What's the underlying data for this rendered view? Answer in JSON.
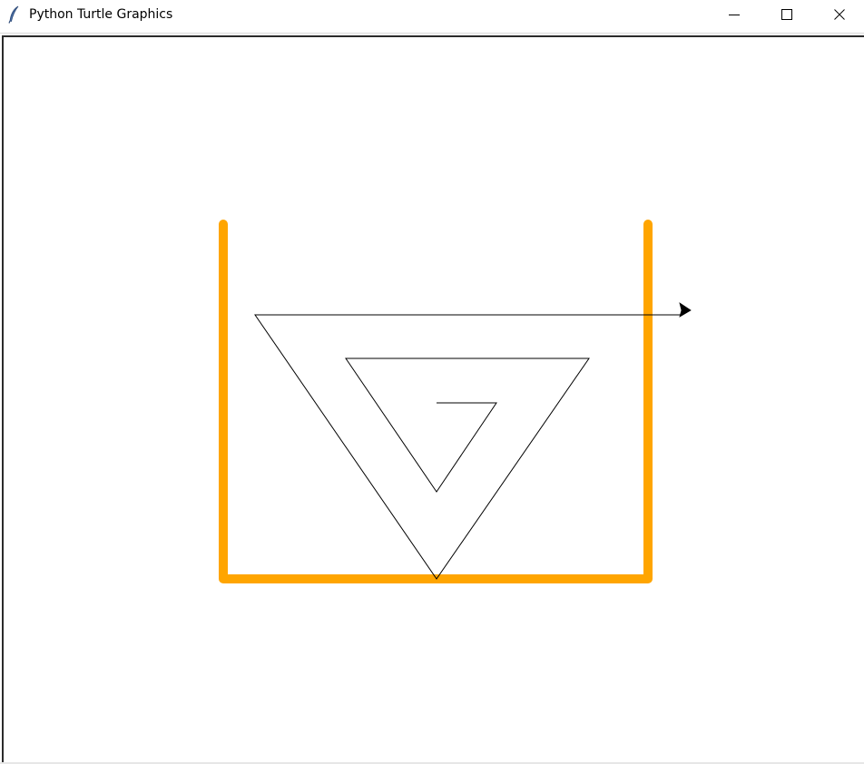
{
  "window": {
    "title": "Python Turtle Graphics",
    "app_icon": "feather-icon",
    "controls": {
      "minimize_icon": "minimize-icon",
      "maximize_icon": "maximize-icon",
      "close_icon": "close-icon"
    }
  },
  "canvas": {
    "background": "#ffffff",
    "cup_color": "#ffa500",
    "spiral_color": "#000000",
    "turtle_color": "#000000"
  }
}
